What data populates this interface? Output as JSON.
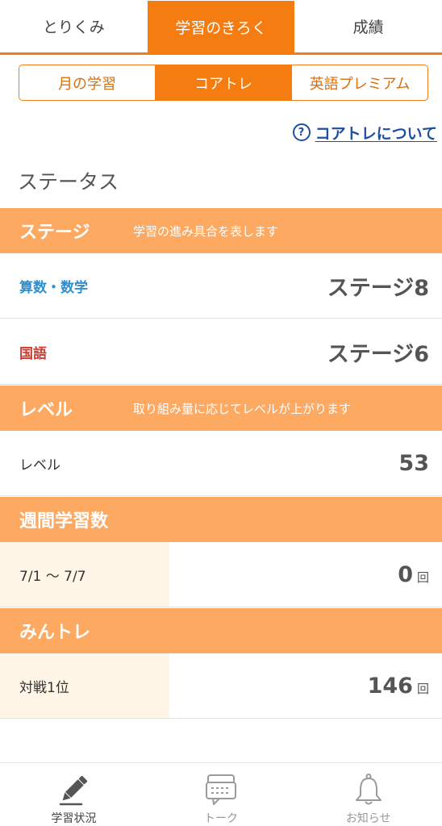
{
  "tabs": [
    {
      "label": "とりくみ"
    },
    {
      "label": "学習のきろく"
    },
    {
      "label": "成績"
    }
  ],
  "segments": [
    {
      "label": "月の学習"
    },
    {
      "label": "コアトレ"
    },
    {
      "label": "英語プレミアム"
    }
  ],
  "about_link": {
    "icon": "question-circle-icon",
    "label": "コアトレについて"
  },
  "status_heading": "ステータス",
  "stage_section": {
    "title": "ステージ",
    "description": "学習の進み具合を表します",
    "rows": [
      {
        "label": "算数・数学",
        "value": "ステージ8"
      },
      {
        "label": "国語",
        "value": "ステージ6"
      }
    ]
  },
  "level_section": {
    "title": "レベル",
    "description": "取り組み量に応じてレベルが上がります",
    "row": {
      "label": "レベル",
      "value": "53"
    }
  },
  "weekly_section": {
    "title": "週間学習数",
    "row": {
      "label": "7/1 ～ 7/7",
      "value": "0",
      "unit": "回"
    }
  },
  "mintore_section": {
    "title": "みんトレ",
    "row": {
      "label": "対戦1位",
      "value": "146",
      "unit": "回"
    }
  },
  "bottom_nav": [
    {
      "label": "学習状況",
      "icon": "pencil-icon"
    },
    {
      "label": "トーク",
      "icon": "chat-icon"
    },
    {
      "label": "お知らせ",
      "icon": "bell-icon"
    }
  ],
  "colors": {
    "accent": "#f57c10",
    "band": "#fda962",
    "link": "#1f4fa3",
    "math": "#2b8fd1",
    "japanese": "#cc3d2f"
  }
}
